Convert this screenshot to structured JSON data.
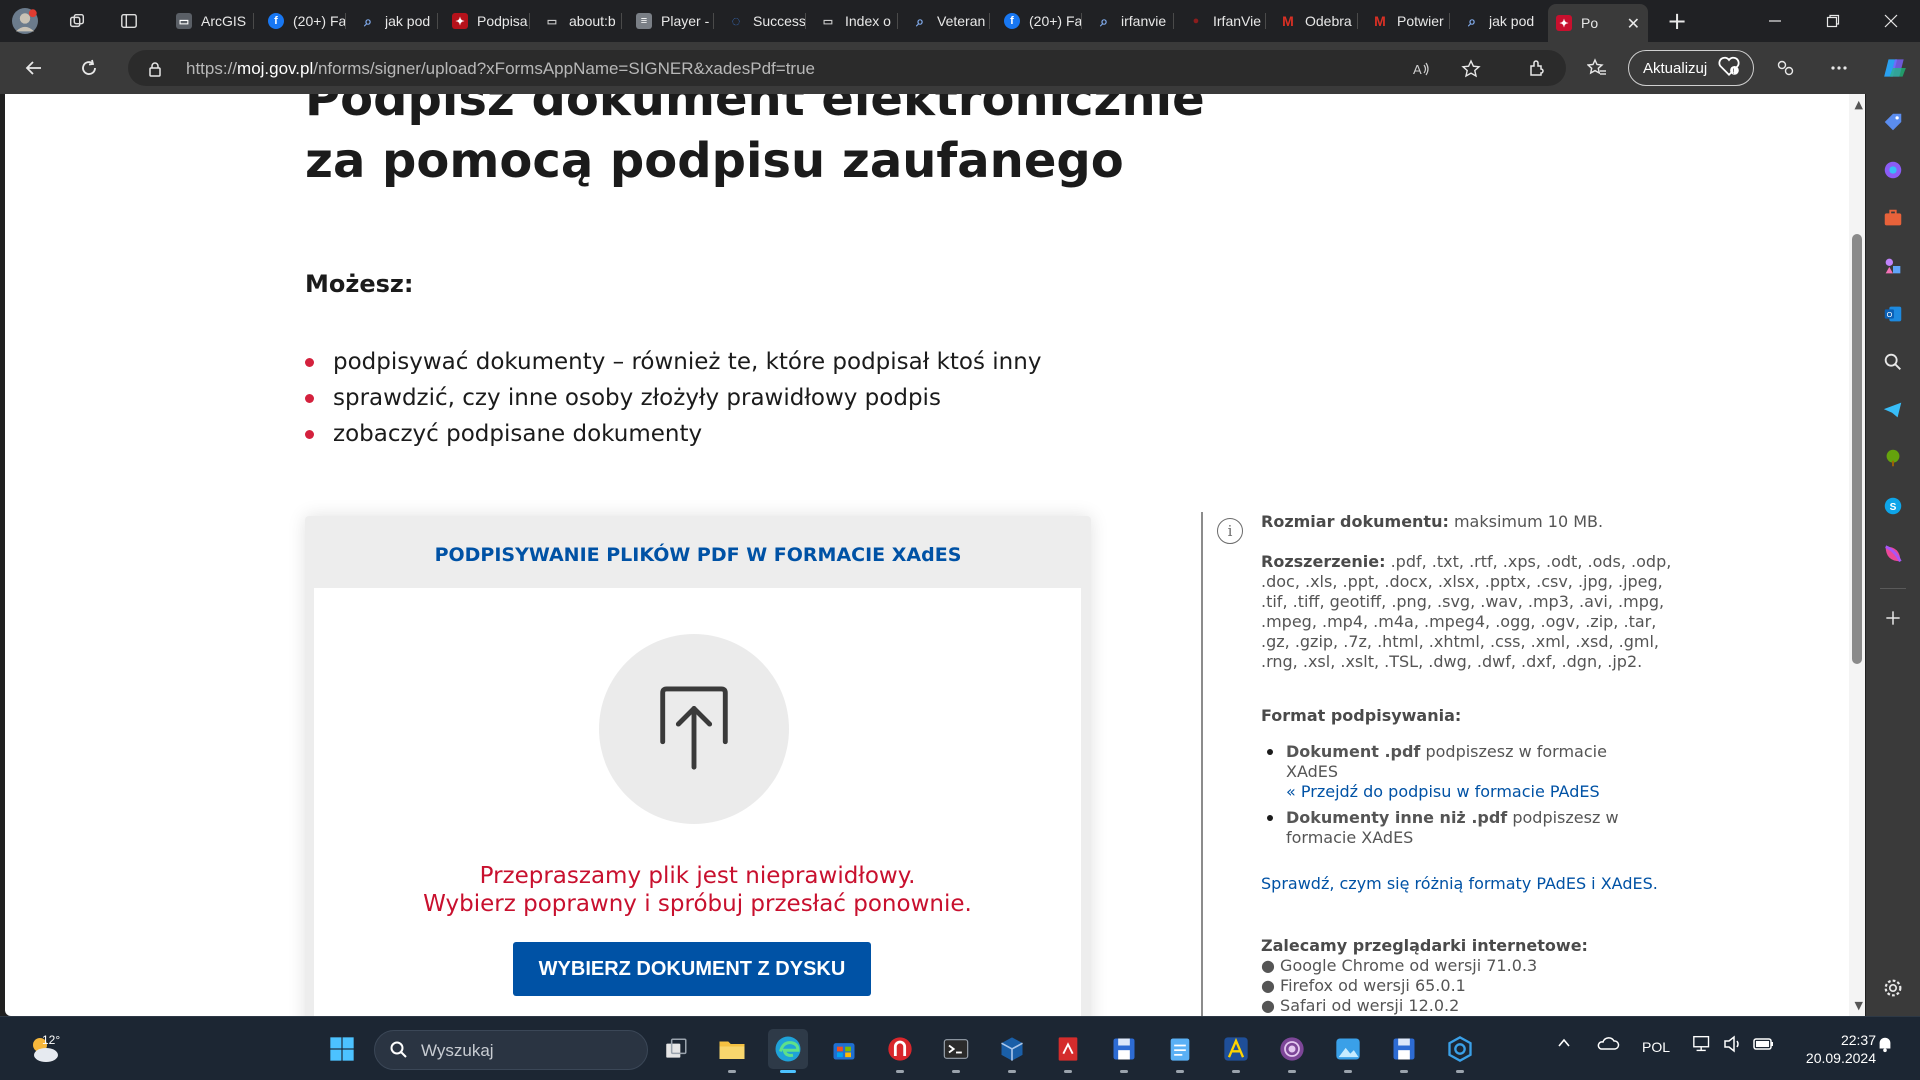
{
  "browser": {
    "tabs": [
      {
        "title": "ArcGIS",
        "color": "#5a5f66",
        "glyph": "▭"
      },
      {
        "title": "(20+) Fa",
        "color": "#1877f2",
        "glyph": "f"
      },
      {
        "title": "jak pod",
        "color": "#3c6fbf",
        "glyph": "⌕"
      },
      {
        "title": "Podpisa",
        "color": "#b5121b",
        "glyph": "✦"
      },
      {
        "title": "about:b",
        "color": "#5a5f66",
        "glyph": "▭"
      },
      {
        "title": "Player -",
        "color": "#7a7f86",
        "glyph": "≡"
      },
      {
        "title": "Success",
        "color": "#3d7bd9",
        "glyph": "◌"
      },
      {
        "title": "Index o",
        "color": "#5a5f66",
        "glyph": "▭"
      },
      {
        "title": "Veteran",
        "color": "#3c6fbf",
        "glyph": "⌕"
      },
      {
        "title": "(20+) Fa",
        "color": "#1877f2",
        "glyph": "f"
      },
      {
        "title": "irfanvie",
        "color": "#3c6fbf",
        "glyph": "⌕"
      },
      {
        "title": "IrfanVie",
        "color": "#8b1d1d",
        "glyph": "●"
      },
      {
        "title": "Odebra",
        "color": "#d93025",
        "glyph": "M"
      },
      {
        "title": "Potwier",
        "color": "#d93025",
        "glyph": "M"
      },
      {
        "title": "jak pod",
        "color": "#3c6fbf",
        "glyph": "⌕"
      },
      {
        "title": "Po",
        "color": "#c8102e",
        "glyph": "✦"
      }
    ],
    "close_tab_glyph": "✕",
    "new_tab_glyph": "+",
    "url_prefix": "https://",
    "url_host": "moj.gov.pl",
    "url_path": "/nforms/signer/upload?xFormsAppName=SIGNER&xadesPdf=true",
    "update_label": "Aktualizuj"
  },
  "page": {
    "heading_line1": "Podpisz dokument elektronicznie",
    "heading_line2": "za pomocą podpisu zaufanego",
    "can_label": "Możesz:",
    "can_items": [
      "podpisywać dokumenty – również te, które podpisał ktoś inny",
      "sprawdzić, czy inne osoby złożyły prawidłowy podpis",
      "zobaczyć podpisane dokumenty"
    ],
    "card_title": "PODPISYWANIE PLIKÓW PDF W FORMACIE XAdES",
    "error_line1": "Przepraszamy plik jest nieprawidłowy.",
    "error_line2": "Wybierz poprawny i spróbuj przesłać ponownie.",
    "choose_button": "WYBIERZ DOKUMENT Z DYSKU",
    "accent_color": "#0052a5",
    "error_color": "#c8102e"
  },
  "info": {
    "info_glyph": "i",
    "size_label": "Rozmiar dokumentu:",
    "size_value": " maksimum 10 MB.",
    "ext_label": "Rozszerzenie:",
    "ext_value": " .pdf, .txt, .rtf, .xps, .odt, .ods, .odp, .doc, .xls, .ppt, .docx, .xlsx, .pptx, .csv, .jpg, .jpeg, .tif, .tiff, geotiff, .png, .svg, .wav, .mp3, .avi, .mpg, .mpeg, .mp4, .m4a, .mpeg4, .ogg, .ogv, .zip, .tar, .gz, .gzip, .7z, .html, .xhtml, .css, .xml, .xsd, .gml, .rng, .xsl, .xslt, .TSL, .dwg, .dwf, .dxf, .dgn, .jp2.",
    "format_label": "Format podpisywania:",
    "pdf_bold": "Dokument .pdf",
    "pdf_text": " podpiszesz w formacie XAdES",
    "pades_link": "« Przejdź do podpisu w formacie PAdES",
    "other_bold": "Dokumenty inne niż .pdf",
    "other_text": " podpiszesz w formacie XAdES",
    "diff_link": "Sprawdź, czym się różnią formaty PAdES i XAdES.",
    "browsers_label": "Zalecamy przeglądarki internetowe:",
    "browsers": [
      "● Google Chrome od wersji 71.0.3",
      "● Firefox od wersji 65.0.1",
      "● Safari od wersji 12.0.2"
    ]
  },
  "taskbar": {
    "weather_temp": "12°",
    "search_placeholder": "Wyszukaj",
    "language": "POL",
    "time": "22:37",
    "date": "20.09.2024"
  }
}
